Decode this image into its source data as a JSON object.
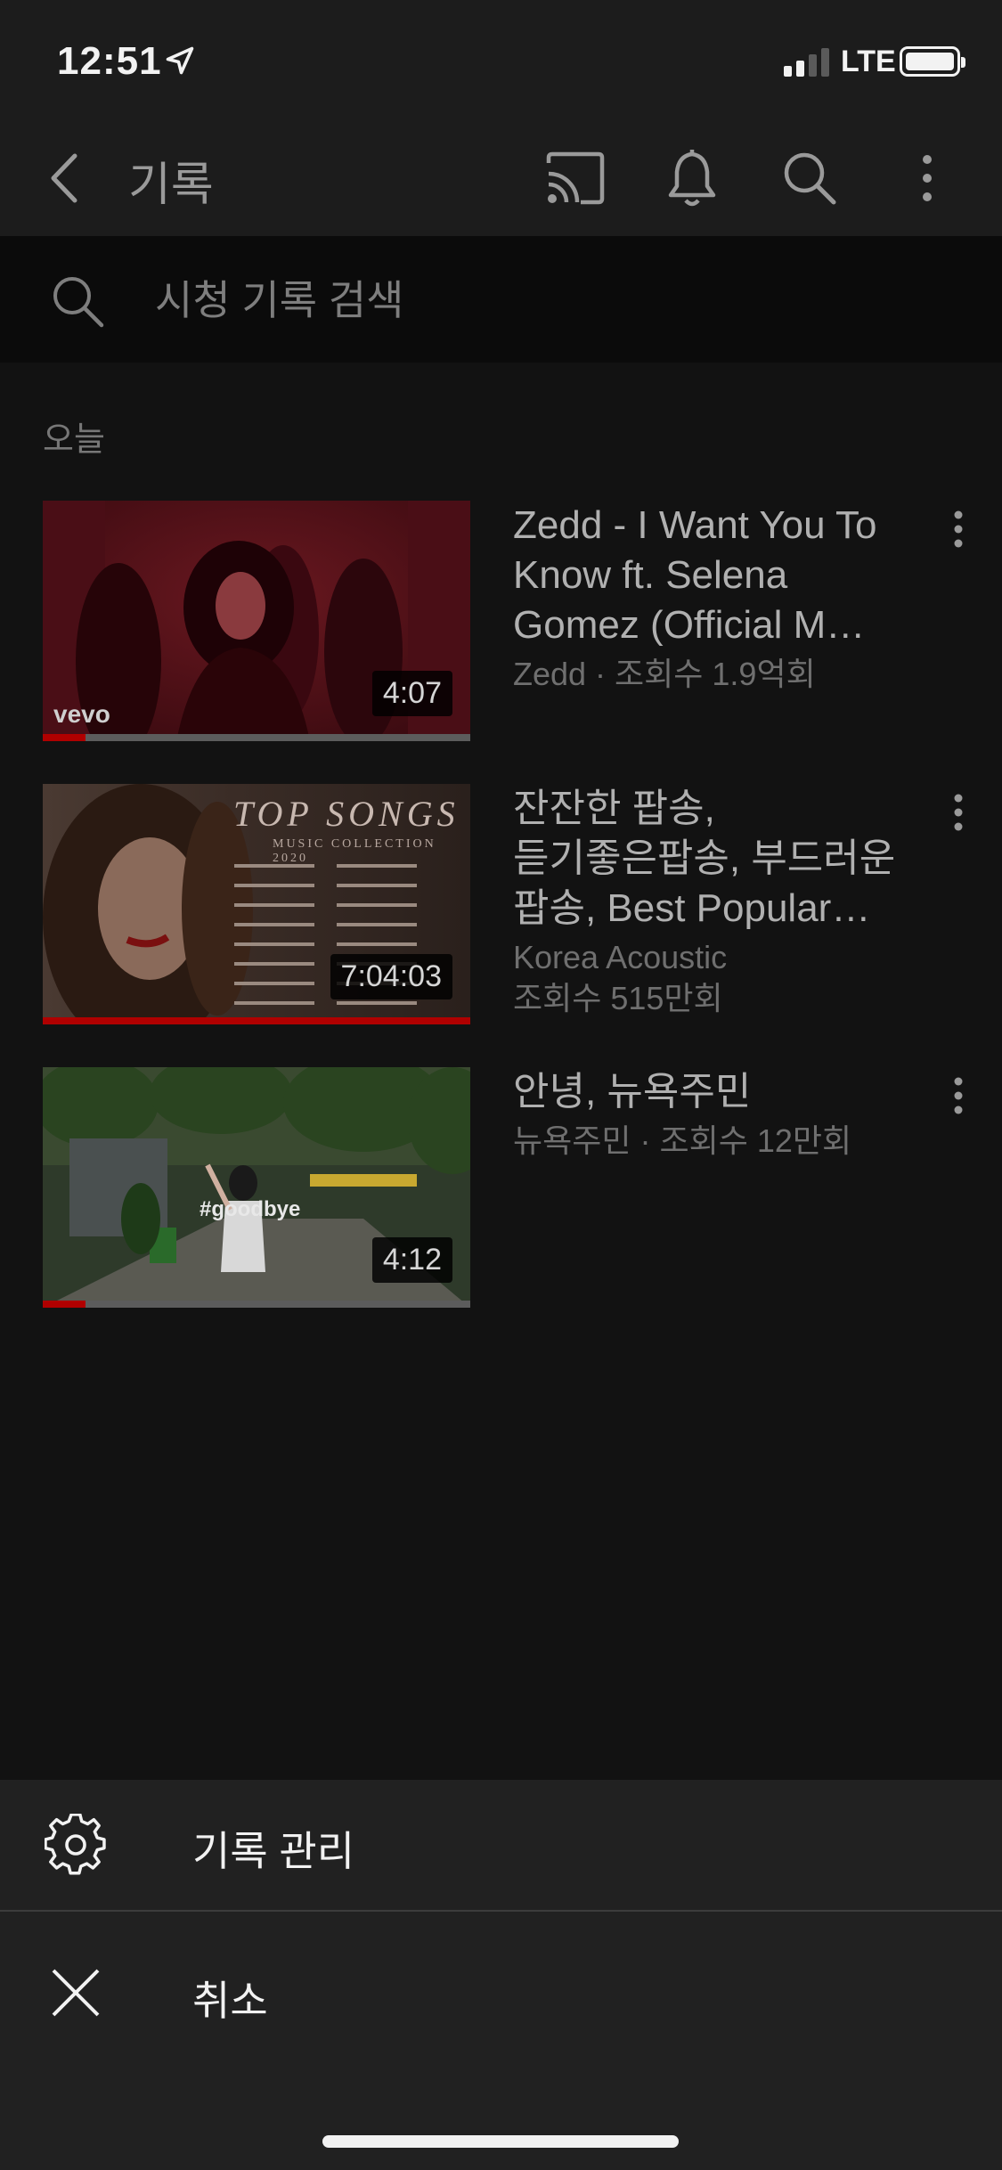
{
  "status_bar": {
    "time": "12:51",
    "network": "LTE",
    "location_icon": "location-arrow-icon",
    "signal_bars": 2,
    "battery_level": 1.0
  },
  "app_bar": {
    "title": "기록",
    "icons": [
      "back-arrow-icon",
      "cast-icon",
      "bell-icon",
      "search-icon",
      "more-vertical-icon"
    ]
  },
  "search": {
    "placeholder": "시청 기록 검색"
  },
  "section": {
    "label": "오늘"
  },
  "videos": [
    {
      "title_lines": [
        "Zedd - I Want You To",
        "Know ft. Selena",
        "Gomez (Official M…"
      ],
      "meta_lines": [
        "Zedd · 조회수 1.9억회"
      ],
      "duration": "4:07",
      "thumb_watermark": "vevo",
      "watched_fraction": 0.1
    },
    {
      "title_lines": [
        "잔잔한 팝송,",
        "듣기좋은팝송, 부드러운",
        "팝송, Best Popular…"
      ],
      "meta_lines": [
        "Korea Acoustic",
        "조회수 515만회"
      ],
      "duration": "7:04:03",
      "thumb_heading": "TOP SONGS",
      "thumb_subheading": "MUSIC COLLECTION 2020",
      "watched_fraction": 1.0
    },
    {
      "title_lines": [
        "안녕, 뉴욕주민"
      ],
      "meta_lines": [
        "뉴욕주민 · 조회수 12만회"
      ],
      "duration": "4:12",
      "thumb_caption": "#goodbye",
      "watched_fraction": 0.1
    }
  ],
  "sheet": {
    "manage_label": "기록 관리",
    "manage_icon": "gear-icon",
    "cancel_label": "취소",
    "cancel_icon": "close-icon"
  },
  "colors": {
    "background": "#121212",
    "bar": "#1c1c1c",
    "sheet": "#212121",
    "progress": "#b00000",
    "title_text": "#b0b0b0",
    "meta_text": "#6f6f6f"
  }
}
